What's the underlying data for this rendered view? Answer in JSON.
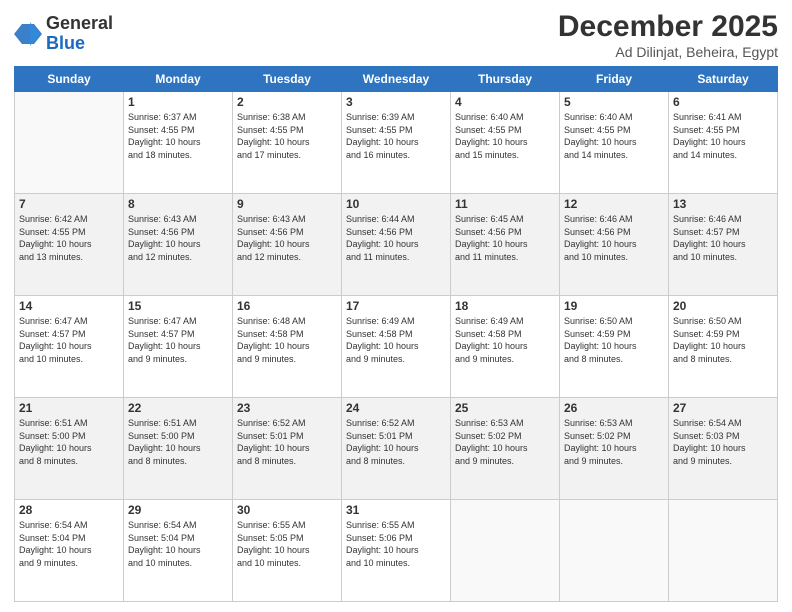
{
  "header": {
    "logo_general": "General",
    "logo_blue": "Blue",
    "month_title": "December 2025",
    "location": "Ad Dilinjat, Beheira, Egypt"
  },
  "days_of_week": [
    "Sunday",
    "Monday",
    "Tuesday",
    "Wednesday",
    "Thursday",
    "Friday",
    "Saturday"
  ],
  "weeks": [
    [
      {
        "day": "",
        "info": ""
      },
      {
        "day": "1",
        "info": "Sunrise: 6:37 AM\nSunset: 4:55 PM\nDaylight: 10 hours\nand 18 minutes."
      },
      {
        "day": "2",
        "info": "Sunrise: 6:38 AM\nSunset: 4:55 PM\nDaylight: 10 hours\nand 17 minutes."
      },
      {
        "day": "3",
        "info": "Sunrise: 6:39 AM\nSunset: 4:55 PM\nDaylight: 10 hours\nand 16 minutes."
      },
      {
        "day": "4",
        "info": "Sunrise: 6:40 AM\nSunset: 4:55 PM\nDaylight: 10 hours\nand 15 minutes."
      },
      {
        "day": "5",
        "info": "Sunrise: 6:40 AM\nSunset: 4:55 PM\nDaylight: 10 hours\nand 14 minutes."
      },
      {
        "day": "6",
        "info": "Sunrise: 6:41 AM\nSunset: 4:55 PM\nDaylight: 10 hours\nand 14 minutes."
      }
    ],
    [
      {
        "day": "7",
        "info": "Sunrise: 6:42 AM\nSunset: 4:55 PM\nDaylight: 10 hours\nand 13 minutes."
      },
      {
        "day": "8",
        "info": "Sunrise: 6:43 AM\nSunset: 4:56 PM\nDaylight: 10 hours\nand 12 minutes."
      },
      {
        "day": "9",
        "info": "Sunrise: 6:43 AM\nSunset: 4:56 PM\nDaylight: 10 hours\nand 12 minutes."
      },
      {
        "day": "10",
        "info": "Sunrise: 6:44 AM\nSunset: 4:56 PM\nDaylight: 10 hours\nand 11 minutes."
      },
      {
        "day": "11",
        "info": "Sunrise: 6:45 AM\nSunset: 4:56 PM\nDaylight: 10 hours\nand 11 minutes."
      },
      {
        "day": "12",
        "info": "Sunrise: 6:46 AM\nSunset: 4:56 PM\nDaylight: 10 hours\nand 10 minutes."
      },
      {
        "day": "13",
        "info": "Sunrise: 6:46 AM\nSunset: 4:57 PM\nDaylight: 10 hours\nand 10 minutes."
      }
    ],
    [
      {
        "day": "14",
        "info": "Sunrise: 6:47 AM\nSunset: 4:57 PM\nDaylight: 10 hours\nand 10 minutes."
      },
      {
        "day": "15",
        "info": "Sunrise: 6:47 AM\nSunset: 4:57 PM\nDaylight: 10 hours\nand 9 minutes."
      },
      {
        "day": "16",
        "info": "Sunrise: 6:48 AM\nSunset: 4:58 PM\nDaylight: 10 hours\nand 9 minutes."
      },
      {
        "day": "17",
        "info": "Sunrise: 6:49 AM\nSunset: 4:58 PM\nDaylight: 10 hours\nand 9 minutes."
      },
      {
        "day": "18",
        "info": "Sunrise: 6:49 AM\nSunset: 4:58 PM\nDaylight: 10 hours\nand 9 minutes."
      },
      {
        "day": "19",
        "info": "Sunrise: 6:50 AM\nSunset: 4:59 PM\nDaylight: 10 hours\nand 8 minutes."
      },
      {
        "day": "20",
        "info": "Sunrise: 6:50 AM\nSunset: 4:59 PM\nDaylight: 10 hours\nand 8 minutes."
      }
    ],
    [
      {
        "day": "21",
        "info": "Sunrise: 6:51 AM\nSunset: 5:00 PM\nDaylight: 10 hours\nand 8 minutes."
      },
      {
        "day": "22",
        "info": "Sunrise: 6:51 AM\nSunset: 5:00 PM\nDaylight: 10 hours\nand 8 minutes."
      },
      {
        "day": "23",
        "info": "Sunrise: 6:52 AM\nSunset: 5:01 PM\nDaylight: 10 hours\nand 8 minutes."
      },
      {
        "day": "24",
        "info": "Sunrise: 6:52 AM\nSunset: 5:01 PM\nDaylight: 10 hours\nand 8 minutes."
      },
      {
        "day": "25",
        "info": "Sunrise: 6:53 AM\nSunset: 5:02 PM\nDaylight: 10 hours\nand 9 minutes."
      },
      {
        "day": "26",
        "info": "Sunrise: 6:53 AM\nSunset: 5:02 PM\nDaylight: 10 hours\nand 9 minutes."
      },
      {
        "day": "27",
        "info": "Sunrise: 6:54 AM\nSunset: 5:03 PM\nDaylight: 10 hours\nand 9 minutes."
      }
    ],
    [
      {
        "day": "28",
        "info": "Sunrise: 6:54 AM\nSunset: 5:04 PM\nDaylight: 10 hours\nand 9 minutes."
      },
      {
        "day": "29",
        "info": "Sunrise: 6:54 AM\nSunset: 5:04 PM\nDaylight: 10 hours\nand 10 minutes."
      },
      {
        "day": "30",
        "info": "Sunrise: 6:55 AM\nSunset: 5:05 PM\nDaylight: 10 hours\nand 10 minutes."
      },
      {
        "day": "31",
        "info": "Sunrise: 6:55 AM\nSunset: 5:06 PM\nDaylight: 10 hours\nand 10 minutes."
      },
      {
        "day": "",
        "info": ""
      },
      {
        "day": "",
        "info": ""
      },
      {
        "day": "",
        "info": ""
      }
    ]
  ]
}
